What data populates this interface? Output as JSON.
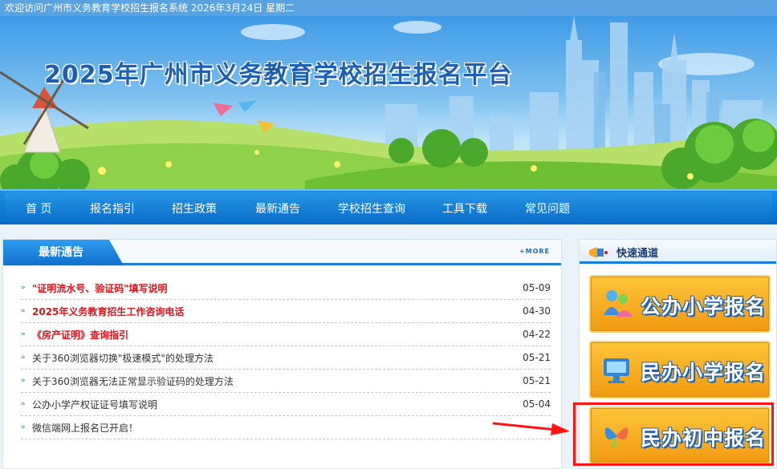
{
  "topbar": {
    "welcome": "欢迎访问广州市义务教育学校招生报名系统  2026年3月24日 星期二"
  },
  "banner": {
    "title": "2025年广州市义务教育学校招生报名平台"
  },
  "nav": {
    "items": [
      {
        "label": "首  页"
      },
      {
        "label": "报名指引"
      },
      {
        "label": "招生政策"
      },
      {
        "label": "最新通告"
      },
      {
        "label": "学校招生查询"
      },
      {
        "label": "工具下载"
      },
      {
        "label": "常见问题"
      }
    ]
  },
  "notices": {
    "title": "最新通告",
    "more": "+MORE",
    "items": [
      {
        "title": "\"证明流水号、验证码\"填写说明",
        "date": "05-09",
        "hot": true
      },
      {
        "title": "2025年义务教育招生工作咨询电话",
        "date": "04-30",
        "hot": true
      },
      {
        "title": "《房产证明》查询指引",
        "date": "04-22",
        "hot": true
      },
      {
        "title": "关于360浏览器切换\"极速模式\"的处理方法",
        "date": "05-21",
        "hot": false
      },
      {
        "title": "关于360浏览器无法正常显示验证码的处理方法",
        "date": "05-21",
        "hot": false
      },
      {
        "title": "公办小学产权证证号填写说明",
        "date": "05-04",
        "hot": false
      },
      {
        "title": "微信端网上报名已开启！",
        "date": "",
        "hot": false
      }
    ]
  },
  "quick": {
    "title": "快速通道",
    "buttons": [
      {
        "label": "公办小学报名",
        "icon": "kids-icon"
      },
      {
        "label": "民办小学报名",
        "icon": "monitor-icon"
      },
      {
        "label": "民办初中报名",
        "icon": "butterfly-icon"
      }
    ]
  },
  "colors": {
    "accent": "#1a7fd6",
    "hot": "#e0121a",
    "button": "#f5a623",
    "highlight": "#ff1414"
  }
}
